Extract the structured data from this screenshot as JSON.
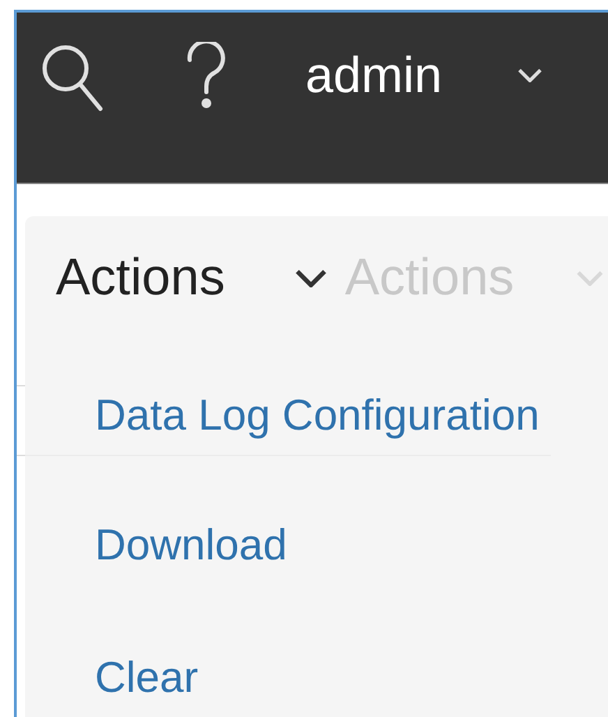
{
  "top_bar": {
    "user": "admin"
  },
  "actions_menu": {
    "label": "Actions",
    "expanded": true,
    "ghost_label": "Actions",
    "items": [
      {
        "label": "Data Log Configuration"
      },
      {
        "label": "Download"
      },
      {
        "label": "Clear"
      }
    ]
  }
}
